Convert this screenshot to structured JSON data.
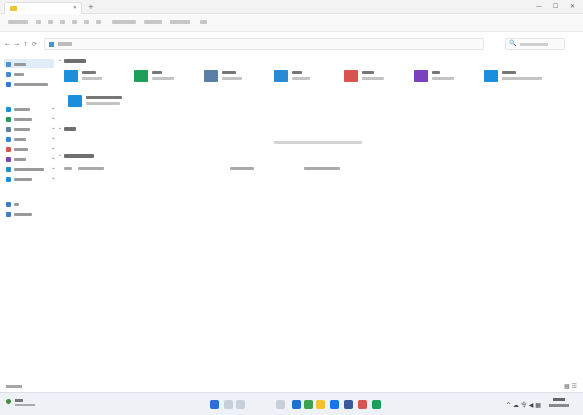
{
  "window": {
    "tab_icon": "folder-icon",
    "tab_close": "✕",
    "new_tab": "+",
    "controls": [
      "—",
      "☐",
      "✕"
    ]
  },
  "nav": {
    "back": "←",
    "forward": "→",
    "up": "↑",
    "refresh": "⟳"
  },
  "search": {
    "icon": "🔍"
  },
  "statusbar": {
    "view_icons": "▦ ☰"
  },
  "taskbar": {
    "tray": "^ ☁ 令 ◀ ▦"
  },
  "colors": {
    "accent": "#1e88d6",
    "selection": "#e0ecf8",
    "folder_desktop": "#1c8fdc",
    "folder_green": "#1e9e5a",
    "folder_docs": "#5b7fa6",
    "folder_music": "#d9534f",
    "folder_video": "#7b3fbf"
  }
}
